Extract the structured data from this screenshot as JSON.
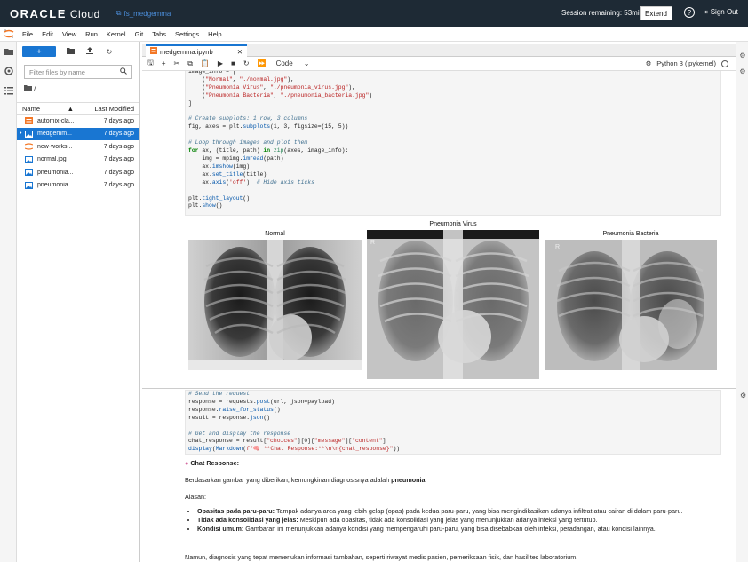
{
  "topbar": {
    "brand_bold": "ORACLE",
    "brand_light": "Cloud",
    "workspace": "fs_medgemma",
    "session": "Session remaining: 53min",
    "extend_label": "Extend",
    "signout_label": "Sign Out"
  },
  "menu": [
    "File",
    "Edit",
    "View",
    "Run",
    "Kernel",
    "Git",
    "Tabs",
    "Settings",
    "Help"
  ],
  "filebrowser": {
    "search_placeholder": "Filter files by name",
    "path": "/",
    "col_name": "Name",
    "col_modified": "Last Modified",
    "files": [
      {
        "name": "automix-cla...",
        "modified": "7 days ago",
        "icon": "notebook-icon",
        "selected": false
      },
      {
        "name": "medgemm...",
        "modified": "7 days ago",
        "icon": "image-icon",
        "selected": true
      },
      {
        "name": "new-works...",
        "modified": "7 days ago",
        "icon": "jupyter-icon",
        "selected": false
      },
      {
        "name": "normal.jpg",
        "modified": "7 days ago",
        "icon": "image-icon",
        "selected": false
      },
      {
        "name": "pneumonia...",
        "modified": "7 days ago",
        "icon": "image-icon",
        "selected": false
      },
      {
        "name": "pneumonia...",
        "modified": "7 days ago",
        "icon": "image-icon",
        "selected": false
      }
    ]
  },
  "notebook": {
    "tab_name": "medgemma.ipynb",
    "cell_type": "Code",
    "kernel": "Python 3 (ipykernel)"
  },
  "plot": {
    "titles": [
      "Normal",
      "Pneumonia Virus",
      "Pneumonia Bacteria"
    ]
  },
  "chat": {
    "heading": "Chat Response:",
    "intro_prefix": "Berdasarkan gambar yang diberikan, kemungkinan diagnosisnya adalah ",
    "intro_diagnosis": "pneumonia",
    "intro_suffix": ".",
    "reasons_label": "Alasan:",
    "bullets": [
      {
        "title": "Opasitas pada paru-paru:",
        "text": " Tampak adanya area yang lebih gelap (opas) pada kedua paru-paru, yang bisa mengindikasikan adanya infiltrat atau cairan di dalam paru-paru."
      },
      {
        "title": "Tidak ada konsolidasi yang jelas:",
        "text": " Meskipun ada opasitas, tidak ada konsolidasi yang jelas yang menunjukkan adanya infeksi yang tertutup."
      },
      {
        "title": "Kondisi umum:",
        "text": " Gambaran ini menunjukkan adanya kondisi yang mempengaruhi paru-paru, yang bisa disebabkan oleh infeksi, peradangan, atau kondisi lainnya."
      }
    ],
    "closing": "Namun, diagnosis yang tepat memerlukan informasi tambahan, seperti riwayat medis pasien, pemeriksaan fisik, dan hasil tes laboratorium."
  },
  "colors": {
    "topbar": "#1e2a35",
    "accent": "#1976d2",
    "jupyter_orange": "#f37726"
  }
}
